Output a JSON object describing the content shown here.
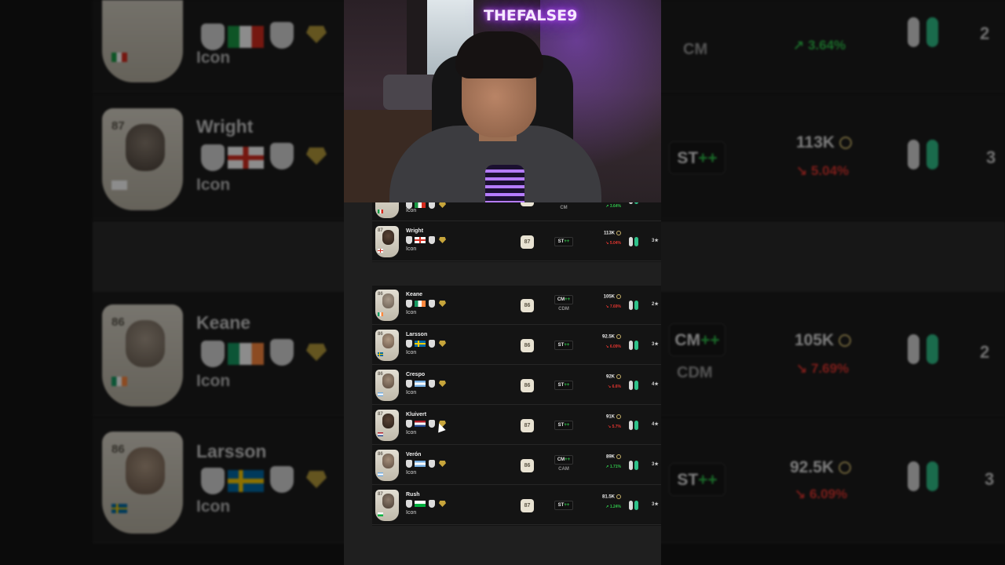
{
  "stream": {
    "neon_sign": "THEFALSE9"
  },
  "background": {
    "rows": [
      {
        "name": "",
        "type": "Icon",
        "flag": "italy",
        "pos": "",
        "alt_pos": "CM",
        "price": "",
        "change": "3.64%",
        "change_dir": "up",
        "skill": "2"
      },
      {
        "name": "Wright",
        "type": "Icon",
        "rating": "87",
        "flag": "england",
        "pos": "ST",
        "alt_pos": "",
        "price": "113K",
        "change": "5.04%",
        "change_dir": "down",
        "skill": "3"
      },
      {
        "name": "Keane",
        "type": "Icon",
        "rating": "86",
        "flag": "ireland",
        "pos": "CM",
        "alt_pos": "CDM",
        "price": "105K",
        "change": "7.69%",
        "change_dir": "down",
        "skill": "2"
      },
      {
        "name": "Larsson",
        "type": "Icon",
        "rating": "86",
        "flag": "sweden",
        "pos": "ST",
        "alt_pos": "",
        "price": "92.5K",
        "change": "6.09%",
        "change_dir": "down",
        "skill": "3"
      }
    ]
  },
  "list": {
    "top_rows": [
      {
        "name": "",
        "type": "Icon",
        "rating": "",
        "flag": "italy",
        "pos": "",
        "alt_pos": "CM",
        "price": "",
        "change": "3.64%",
        "change_dir": "up",
        "skill": "2"
      },
      {
        "name": "Wright",
        "type": "Icon",
        "rating": "87",
        "flag": "england",
        "pos": "ST",
        "plus": "++",
        "alt_pos": "",
        "price": "113K",
        "change": "5.04%",
        "change_dir": "down",
        "skill": "3★"
      }
    ],
    "rows": [
      {
        "name": "Keane",
        "type": "Icon",
        "rating": "86",
        "flag": "ireland",
        "pos": "CM",
        "plus": "++",
        "alt_pos": "CDM",
        "price": "105K",
        "change": "7.69%",
        "change_dir": "down",
        "skill": "2★"
      },
      {
        "name": "Larsson",
        "type": "Icon",
        "rating": "86",
        "flag": "sweden",
        "pos": "ST",
        "plus": "++",
        "alt_pos": "",
        "price": "92.5K",
        "change": "6.09%",
        "change_dir": "down",
        "skill": "3★"
      },
      {
        "name": "Crespo",
        "type": "Icon",
        "rating": "86",
        "flag": "argentina",
        "pos": "ST",
        "plus": "++",
        "alt_pos": "",
        "price": "92K",
        "change": "6.6%",
        "change_dir": "down",
        "skill": "4★"
      },
      {
        "name": "Kluivert",
        "type": "Icon",
        "rating": "87",
        "flag": "netherlands",
        "pos": "ST",
        "plus": "++",
        "alt_pos": "",
        "price": "91K",
        "change": "5.7%",
        "change_dir": "down",
        "skill": "4★"
      },
      {
        "name": "Verón",
        "type": "Icon",
        "rating": "86",
        "flag": "argentina",
        "pos": "CM",
        "plus": "++",
        "alt_pos": "CAM",
        "price": "89K",
        "change": "1.71%",
        "change_dir": "up",
        "skill": "3★"
      },
      {
        "name": "Rush",
        "type": "Icon",
        "rating": "87",
        "flag": "wales",
        "pos": "ST",
        "plus": "++",
        "alt_pos": "",
        "price": "81.5K",
        "change": "1.24%",
        "change_dir": "up",
        "skill": "3★"
      }
    ]
  },
  "colors": {
    "negative": "#e2352f",
    "positive": "#2fc24a",
    "gold": "#c7a53b"
  }
}
